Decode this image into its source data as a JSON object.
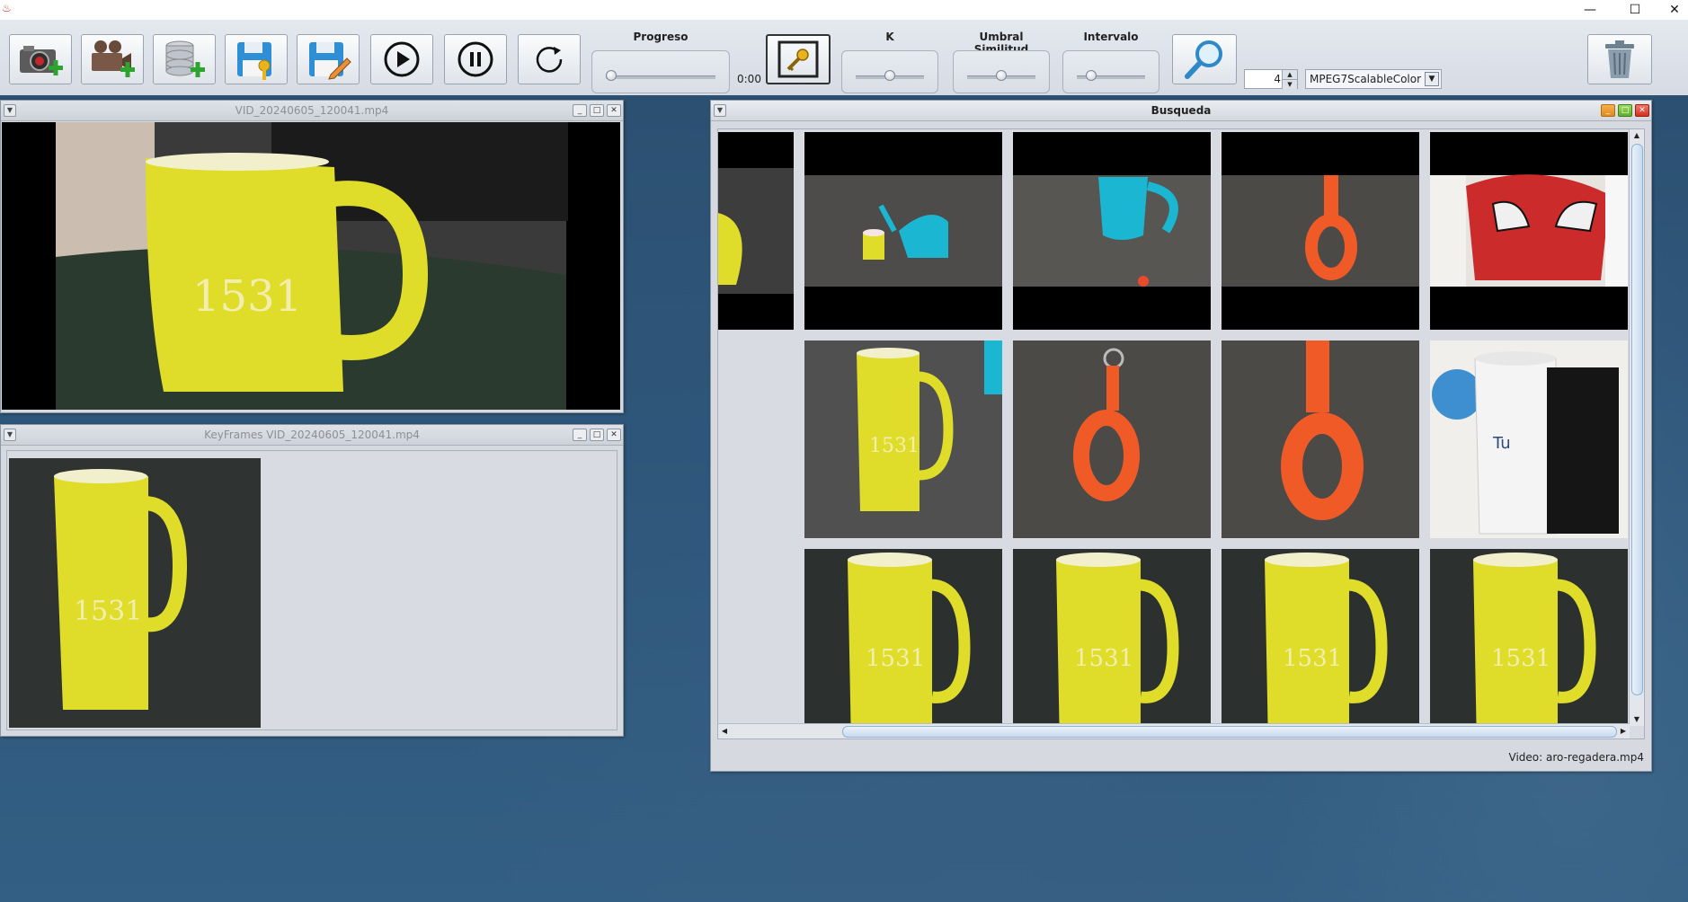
{
  "titlebar": {
    "minimize": "—",
    "maximize": "☐",
    "close": "✕"
  },
  "toolbar": {
    "buttons": [
      {
        "name": "add-image-button",
        "icon": "camera-plus-icon"
      },
      {
        "name": "add-video-button",
        "icon": "video-camera-plus-icon"
      },
      {
        "name": "add-database-button",
        "icon": "database-plus-icon"
      },
      {
        "name": "save-key-button",
        "icon": "floppy-key-icon"
      },
      {
        "name": "save-edit-button",
        "icon": "floppy-pencil-icon"
      },
      {
        "name": "play-button",
        "icon": "play-icon"
      },
      {
        "name": "pause-button",
        "icon": "pause-icon"
      },
      {
        "name": "restart-button",
        "icon": "restart-icon"
      }
    ],
    "progress_label": "Progreso",
    "time": "0:00",
    "k_label": "K",
    "threshold_label": "Umbral Similitud",
    "interval_label": "Intervalo",
    "spinner_value": "4",
    "descriptor": "MPEG7ScalableColor",
    "sliders": {
      "progress": 0.0,
      "k": 0.5,
      "threshold": 0.5,
      "interval": 0.15
    }
  },
  "video_frame": {
    "title": "VID_20240605_120041.mp4"
  },
  "keyframes_frame": {
    "title": "KeyFrames VID_20240605_120041.mp4"
  },
  "search_frame": {
    "title": "Busqueda",
    "status": "Video: aro-regadera.mp4"
  },
  "colors": {
    "mug_yellow": "#e0dd2a",
    "ring_orange": "#ef5a27",
    "can_cyan": "#1ab6d2",
    "desktop_blue": "#2f5576"
  }
}
